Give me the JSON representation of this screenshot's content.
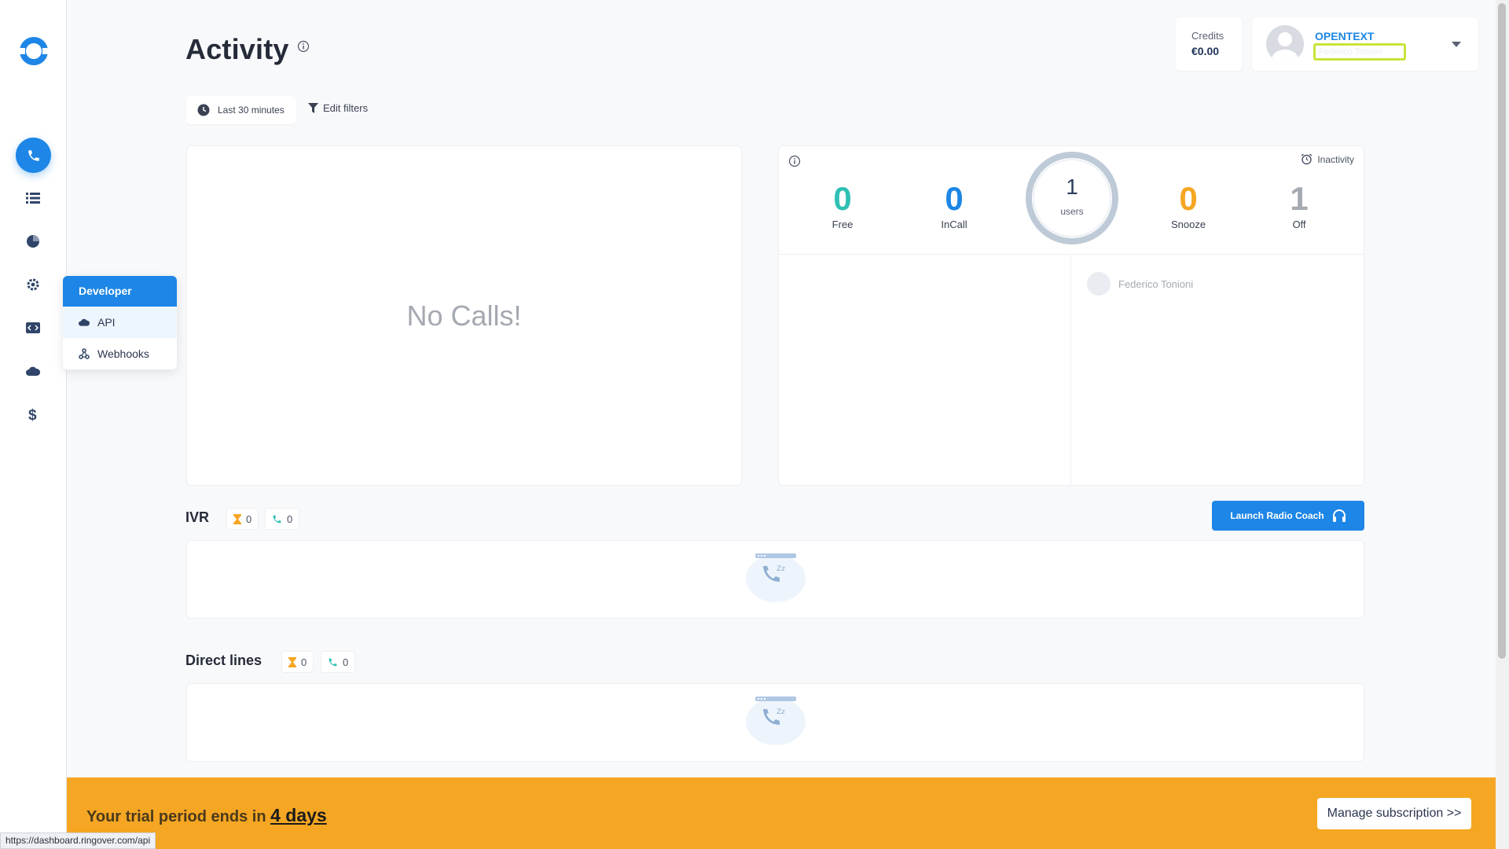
{
  "page": {
    "title": "Activity"
  },
  "account": {
    "credits_label": "Credits",
    "credits_value": "€0.00",
    "company": "OPENTEXT",
    "user_sub": "Federico Tonioni"
  },
  "filters": {
    "time_range": "Last 30 minutes",
    "edit_label": "Edit filters"
  },
  "sidebar": {
    "items": [
      {
        "icon": "phone-icon",
        "active": true
      },
      {
        "icon": "list-icon"
      },
      {
        "icon": "pie-chart-icon"
      },
      {
        "icon": "gear-icon"
      },
      {
        "icon": "code-icon"
      },
      {
        "icon": "cloud-icon"
      },
      {
        "icon": "dollar-icon"
      }
    ]
  },
  "developer_menu": {
    "header": "Developer",
    "items": [
      {
        "label": "API",
        "icon": "cloud-icon",
        "selected": true
      },
      {
        "label": "Webhooks",
        "icon": "webhook-icon"
      }
    ]
  },
  "calls_panel": {
    "empty_text": "No Calls!"
  },
  "stats": {
    "free": {
      "value": "0",
      "label": "Free",
      "color": "#2fc0b4"
    },
    "incall": {
      "value": "0",
      "label": "InCall",
      "color": "#1d86e6"
    },
    "users": {
      "value": "1",
      "label": "users"
    },
    "snooze": {
      "value": "0",
      "label": "Snooze",
      "color": "#f5a623"
    },
    "off": {
      "value": "1",
      "label": "Off",
      "color": "#a5a9b1"
    },
    "inactivity_label": "Inactivity",
    "user_name": "Federico Tonioni"
  },
  "ivr": {
    "title": "IVR",
    "waiting": "0",
    "calls": "0"
  },
  "direct_lines": {
    "title": "Direct lines",
    "waiting": "0",
    "calls": "0"
  },
  "radio_coach": {
    "label": "Launch Radio Coach"
  },
  "banner": {
    "prefix": "Your trial period ends in ",
    "days": "4 days",
    "button": "Manage subscription >>"
  },
  "status_url": "https://dashboard.ringover.com/api",
  "colors": {
    "accent": "#1d86e6",
    "banner": "#f5a623"
  }
}
